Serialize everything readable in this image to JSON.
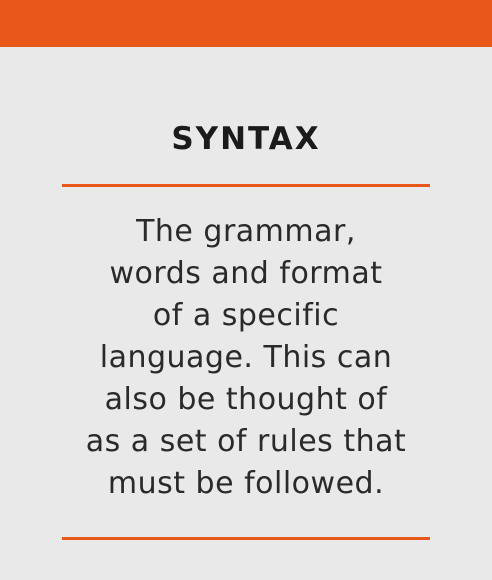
{
  "card": {
    "title": "SYNTAX",
    "definition_lines": [
      "The grammar,",
      "words and format",
      "of a specific",
      "language. This can",
      "also be thought of",
      "as a set of rules that",
      "must be followed."
    ]
  },
  "colors": {
    "accent": "#e8581a",
    "background": "#e9e9e9",
    "text": "#1b1b1b"
  }
}
